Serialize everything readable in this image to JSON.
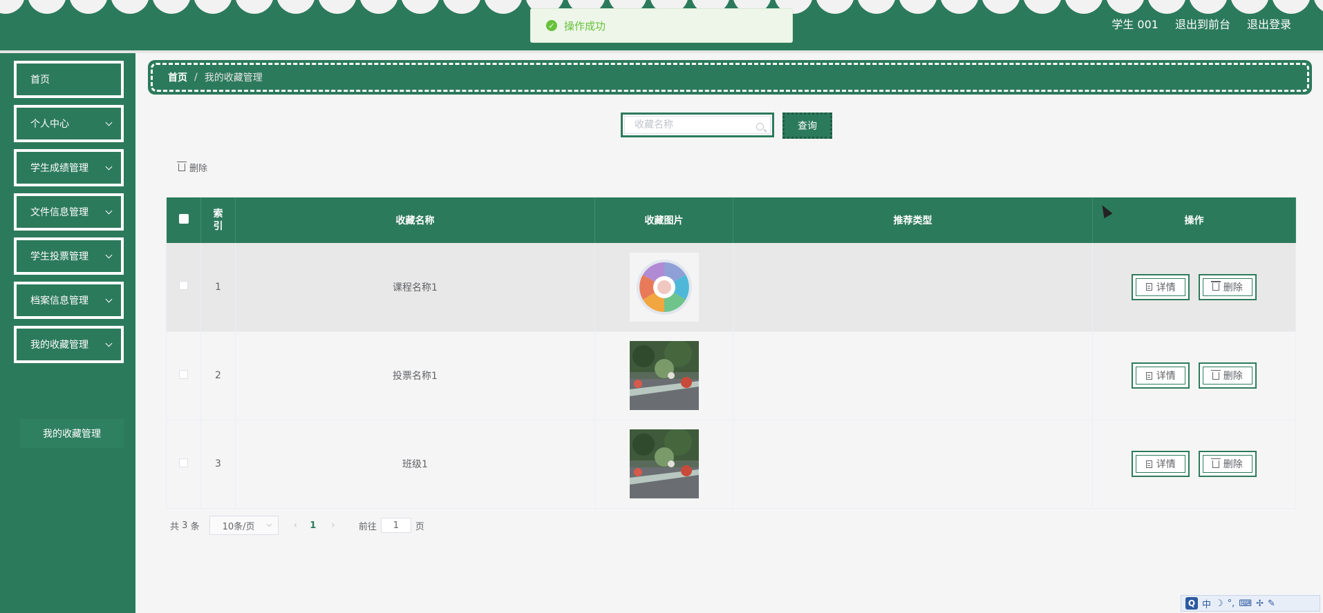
{
  "header": {
    "user": "学生 001",
    "to_front": "退出到前台",
    "logout": "退出登录",
    "toast": "操作成功"
  },
  "sidebar": {
    "items": [
      {
        "label": "首页"
      },
      {
        "label": "个人中心"
      },
      {
        "label": "学生成绩管理"
      },
      {
        "label": "文件信息管理"
      },
      {
        "label": "学生投票管理"
      },
      {
        "label": "档案信息管理"
      },
      {
        "label": "我的收藏管理"
      }
    ],
    "submenu": "我的收藏管理"
  },
  "breadcrumb": {
    "home": "首页",
    "separator": "/",
    "current": "我的收藏管理"
  },
  "search": {
    "placeholder": "收藏名称",
    "button": "查询"
  },
  "toolbar": {
    "delete": "删除"
  },
  "table": {
    "headers": [
      "索引",
      "收藏名称",
      "收藏图片",
      "推荐类型",
      "操作"
    ],
    "rows": [
      {
        "index": "1",
        "name": "课程名称1",
        "type": ""
      },
      {
        "index": "2",
        "name": "投票名称1",
        "type": ""
      },
      {
        "index": "3",
        "name": "班级1",
        "type": ""
      }
    ],
    "detail_label": "详情",
    "delete_label": "删除"
  },
  "pagination": {
    "total_prefix": "共",
    "total": "3",
    "total_suffix": "条",
    "page_size": "10条/页",
    "prev": "‹",
    "current_page": "1",
    "next": "›",
    "goto_label": "前往",
    "goto_value": "1",
    "goto_suffix": "页"
  },
  "ime": {
    "q": "Q",
    "lang": "中",
    "moon": "☽",
    "punct": "°,",
    "keyboard": "⌨",
    "wide": "✢",
    "tools": "✎"
  },
  "colors": {
    "primary": "#2c7a5c",
    "toast_text": "#67c23a"
  }
}
